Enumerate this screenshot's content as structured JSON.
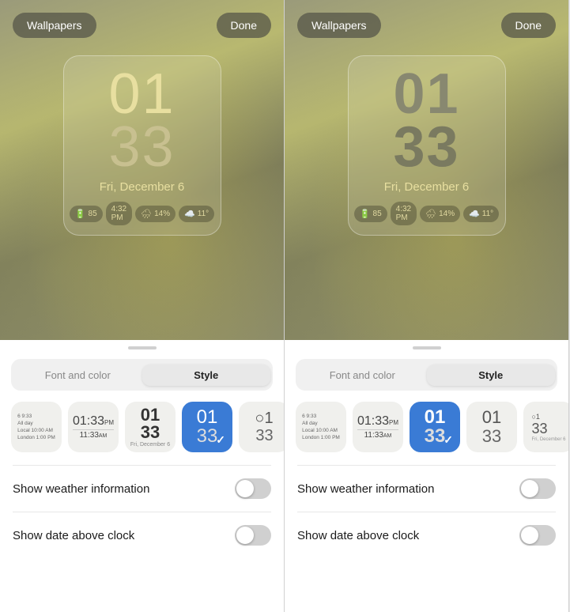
{
  "panels": [
    {
      "id": "left",
      "preview": {
        "wallpapers_btn": "Wallpapers",
        "done_btn": "Done",
        "clock": {
          "hour": "01",
          "minute": "33",
          "date": "Fri, December 6",
          "style": "thin"
        },
        "widgets": [
          {
            "icon": "🔋",
            "value": "85"
          },
          {
            "icon": "",
            "value": "4:32 PM"
          },
          {
            "icon": "🌧️",
            "value": "14%"
          },
          {
            "icon": "☁️",
            "value": "11°"
          }
        ]
      },
      "tabs": {
        "items": [
          {
            "label": "Font and color",
            "active": false
          },
          {
            "label": "Style",
            "active": true
          }
        ]
      },
      "style_thumbs": [
        {
          "type": "multi",
          "selected": false
        },
        {
          "type": "digital-sm",
          "selected": false
        },
        {
          "type": "bold",
          "selected": false
        },
        {
          "type": "selected-thin",
          "selected": true
        },
        {
          "type": "analog",
          "selected": false
        }
      ],
      "toggles": [
        {
          "label": "Show weather information",
          "on": false
        },
        {
          "label": "Show date above clock",
          "on": false
        }
      ]
    },
    {
      "id": "right",
      "preview": {
        "wallpapers_btn": "Wallpapers",
        "done_btn": "Done",
        "clock": {
          "hour": "01",
          "minute": "33",
          "date": "Fri, December 6",
          "style": "bold"
        },
        "widgets": [
          {
            "icon": "🔋",
            "value": "85"
          },
          {
            "icon": "",
            "value": "4:32 PM"
          },
          {
            "icon": "🌧️",
            "value": "14%"
          },
          {
            "icon": "☁️",
            "value": "11°"
          }
        ]
      },
      "tabs": {
        "items": [
          {
            "label": "Font and color",
            "active": false
          },
          {
            "label": "Style",
            "active": true
          }
        ]
      },
      "style_thumbs": [
        {
          "type": "multi",
          "selected": false
        },
        {
          "type": "digital-sm",
          "selected": false
        },
        {
          "type": "selected-bold",
          "selected": true
        },
        {
          "type": "thin-right",
          "selected": false
        },
        {
          "type": "analog2",
          "selected": false
        }
      ],
      "toggles": [
        {
          "label": "Show weather information",
          "on": false
        },
        {
          "label": "Show date above clock",
          "on": false
        }
      ]
    }
  ]
}
